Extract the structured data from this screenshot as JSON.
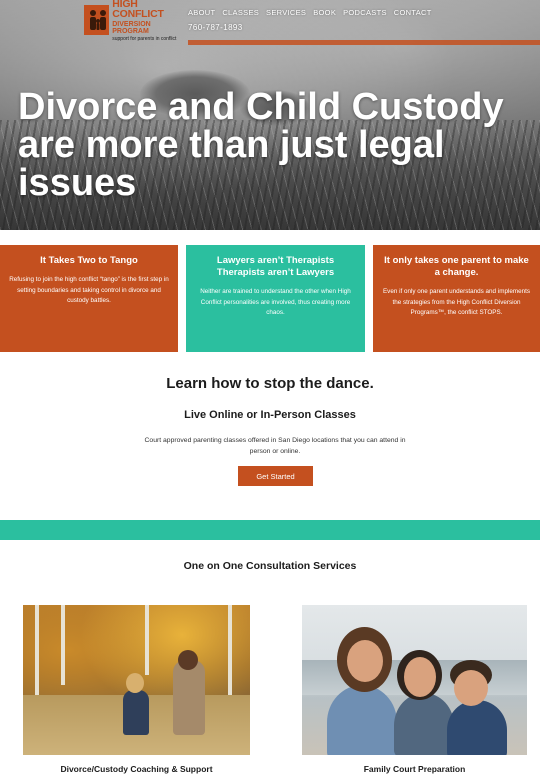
{
  "brand": {
    "title": "HIGH CONFLICT",
    "subtitle": "DIVERSION PROGRAM",
    "tagline": "support for parents in conflict",
    "color_orange": "#c4501f",
    "color_teal": "#2bbf9f"
  },
  "nav": {
    "items": [
      {
        "label": "ABOUT"
      },
      {
        "label": "CLASSES"
      },
      {
        "label": "SERVICES"
      },
      {
        "label": "BOOK"
      },
      {
        "label": "PODCASTS"
      },
      {
        "label": "CONTACT"
      }
    ],
    "phone": "760-787-1893"
  },
  "hero": {
    "title": "Divorce and Child Custody are more than just legal issues"
  },
  "features": [
    {
      "title": "It Takes Two to Tango",
      "body": "Refusing to join the high conflict “tango” is the first step in setting boundaries and taking control in divorce and custody battles."
    },
    {
      "title": "Lawyers aren’t Therapists Therapists aren’t Lawyers",
      "body": "Neither are trained to understand the other when High Conflict personalities are involved, thus creating more chaos."
    },
    {
      "title": "It only takes one parent to make a change.",
      "body": "Even if only one parent understands and implements the strategies from the High Conflict Diversion Programs™, the conflict STOPS."
    }
  ],
  "learn": {
    "title": "Learn how to stop the dance.",
    "classes_title": "Live Online or In-Person Classes",
    "classes_desc": "Court approved parenting classes offered in San Diego locations that you can attend in person or online.",
    "cta_label": "Get Started"
  },
  "consult": {
    "title": "One on One Consultation Services",
    "cards": [
      {
        "caption": "Divorce/Custody Coaching & Support"
      },
      {
        "caption": "Family Court Preparation"
      }
    ]
  }
}
